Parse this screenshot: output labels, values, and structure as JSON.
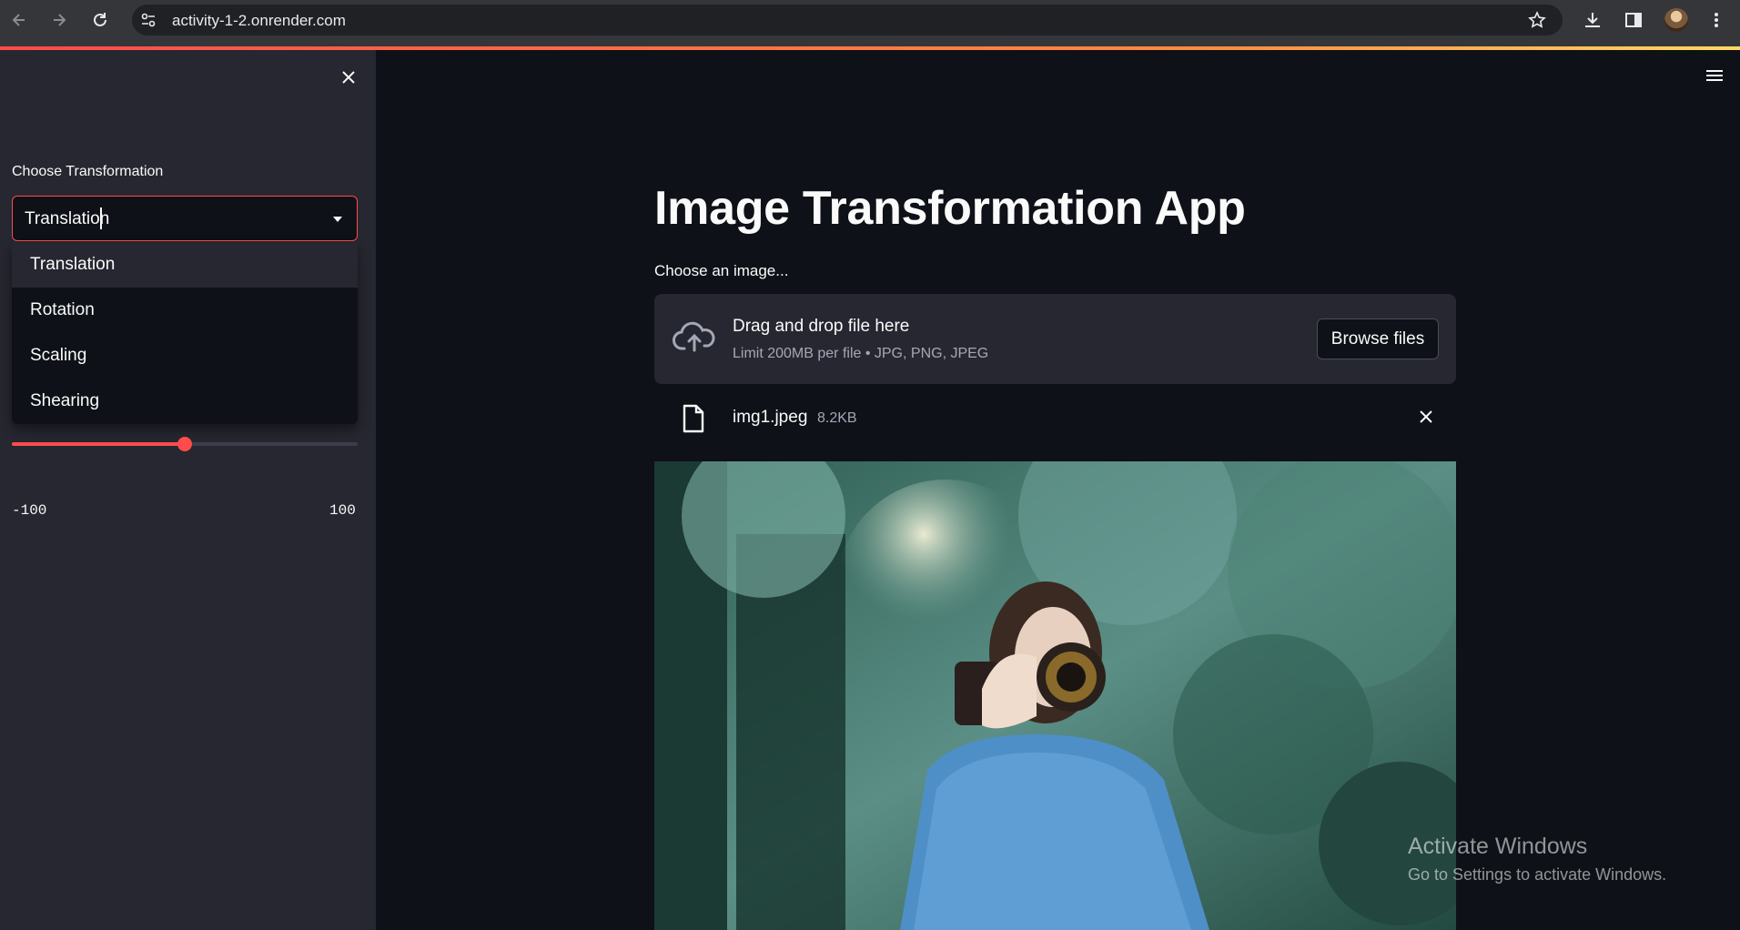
{
  "browser": {
    "url": "activity-1-2.onrender.com",
    "icons": [
      "back-icon",
      "forward-icon",
      "reload-icon",
      "site-settings-icon",
      "bookmark-star-icon",
      "download-icon",
      "side-panel-icon",
      "profile-avatar",
      "more-menu-icon"
    ]
  },
  "sidebar": {
    "label": "Choose Transformation",
    "select_value": "Translation",
    "options": [
      "Translation",
      "Rotation",
      "Scaling",
      "Shearing"
    ],
    "highlighted_option": "Translation",
    "slider": {
      "min": "-100",
      "max": "100",
      "value": 0
    }
  },
  "main": {
    "title": "Image Transformation App",
    "uploader_label": "Choose an image...",
    "dropzone": {
      "title": "Drag and drop file here",
      "subtitle": "Limit 200MB per file • JPG, PNG, JPEG",
      "browse_label": "Browse files"
    },
    "file": {
      "name": "img1.jpeg",
      "size": "8.2KB"
    }
  },
  "watermark": {
    "line1": "Activate Windows",
    "line2": "Go to Settings to activate Windows."
  },
  "colors": {
    "accent": "#ff4b4b",
    "background": "#0e1117",
    "sidebar": "#262730"
  }
}
